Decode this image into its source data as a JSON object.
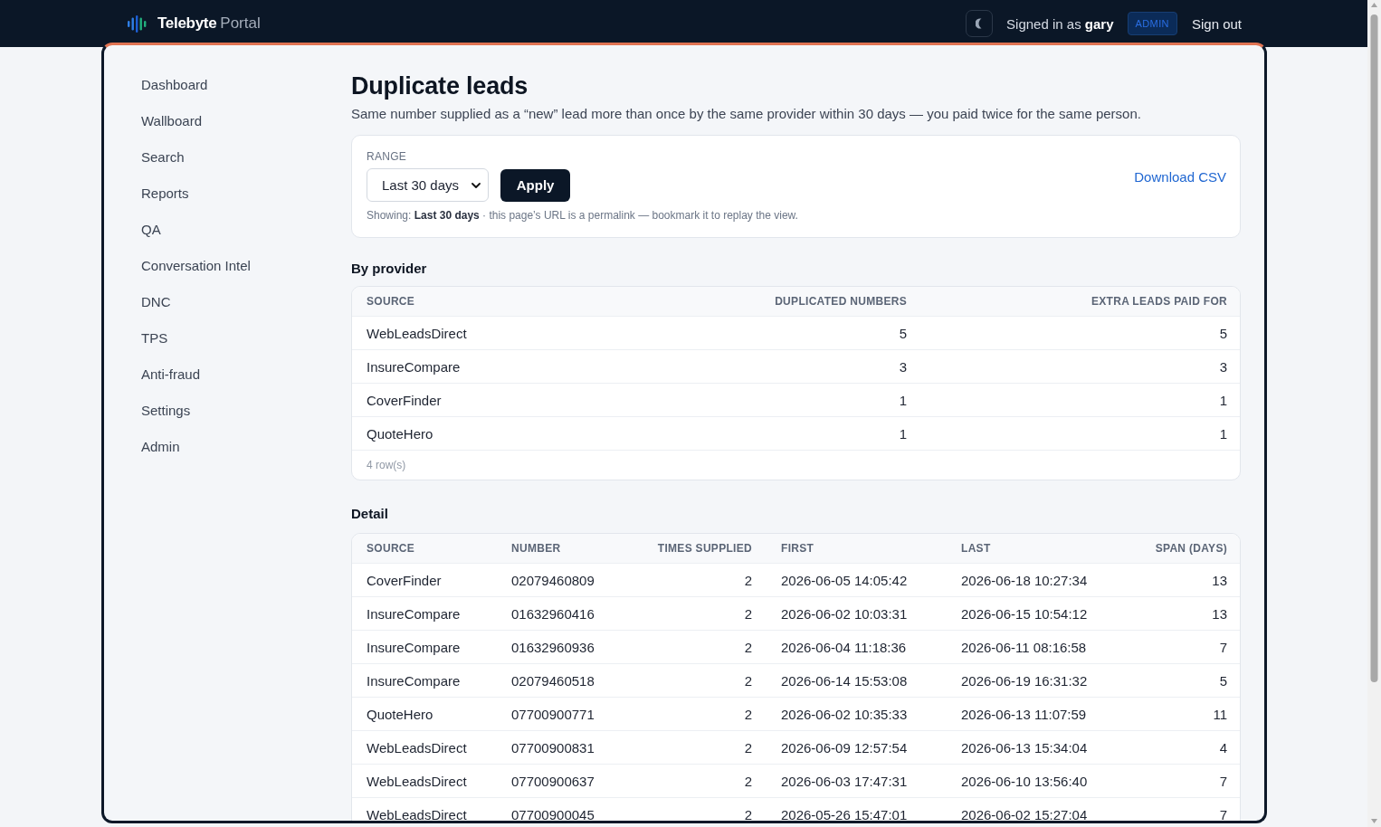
{
  "header": {
    "brand": {
      "name": "Telebyte",
      "product": "Portal"
    },
    "user_text": "Signed in as **gary**",
    "role_badge": "ADMIN",
    "sign_out": "Sign out"
  },
  "sidebar": {
    "items": [
      "Dashboard",
      "Wallboard",
      "Search",
      "Reports",
      "QA",
      "Conversation Intel",
      "DNC",
      "TPS",
      "Anti-fraud",
      "Settings",
      "Admin"
    ]
  },
  "page": {
    "title": "Duplicate leads",
    "subtitle": "Same number supplied as a “new” lead more than once by the same provider within 30 days — you paid twice for the same person."
  },
  "filter": {
    "label": "RANGE",
    "range": "Last 30 days",
    "apply": "Apply",
    "note": "Showing: **Last 30 days** · this page’s URL is a permalink — bookmark it to replay the view.",
    "download": "Download CSV"
  },
  "by_provider": {
    "title": "By provider",
    "columns": [
      "SOURCE",
      "DUPLICATED NUMBERS",
      "EXTRA LEADS PAID FOR"
    ],
    "rows": [
      [
        "WebLeadsDirect",
        "5",
        "5"
      ],
      [
        "InsureCompare",
        "3",
        "3"
      ],
      [
        "CoverFinder",
        "1",
        "1"
      ],
      [
        "QuoteHero",
        "1",
        "1"
      ]
    ],
    "footer": "4 row(s)"
  },
  "detail": {
    "title": "Detail",
    "columns": [
      "SOURCE",
      "NUMBER",
      "TIMES SUPPLIED",
      "FIRST",
      "LAST",
      "SPAN (DAYS)"
    ],
    "rows": [
      [
        "CoverFinder",
        "02079460809",
        "2",
        "2026-06-05 14:05:42",
        "2026-06-18 10:27:34",
        "13"
      ],
      [
        "InsureCompare",
        "01632960416",
        "2",
        "2026-06-02 10:03:31",
        "2026-06-15 10:54:12",
        "13"
      ],
      [
        "InsureCompare",
        "01632960936",
        "2",
        "2026-06-04 11:18:36",
        "2026-06-11 08:16:58",
        "7"
      ],
      [
        "InsureCompare",
        "02079460518",
        "2",
        "2026-06-14 15:53:08",
        "2026-06-19 16:31:32",
        "5"
      ],
      [
        "QuoteHero",
        "07700900771",
        "2",
        "2026-06-02 10:35:33",
        "2026-06-13 11:07:59",
        "11"
      ],
      [
        "WebLeadsDirect",
        "07700900831",
        "2",
        "2026-06-09 12:57:54",
        "2026-06-13 15:34:04",
        "4"
      ],
      [
        "WebLeadsDirect",
        "07700900637",
        "2",
        "2026-06-03 17:47:31",
        "2026-06-10 13:56:40",
        "7"
      ],
      [
        "WebLeadsDirect",
        "07700900045",
        "2",
        "2026-05-26 15:47:01",
        "2026-06-02 15:27:04",
        "7"
      ]
    ]
  }
}
